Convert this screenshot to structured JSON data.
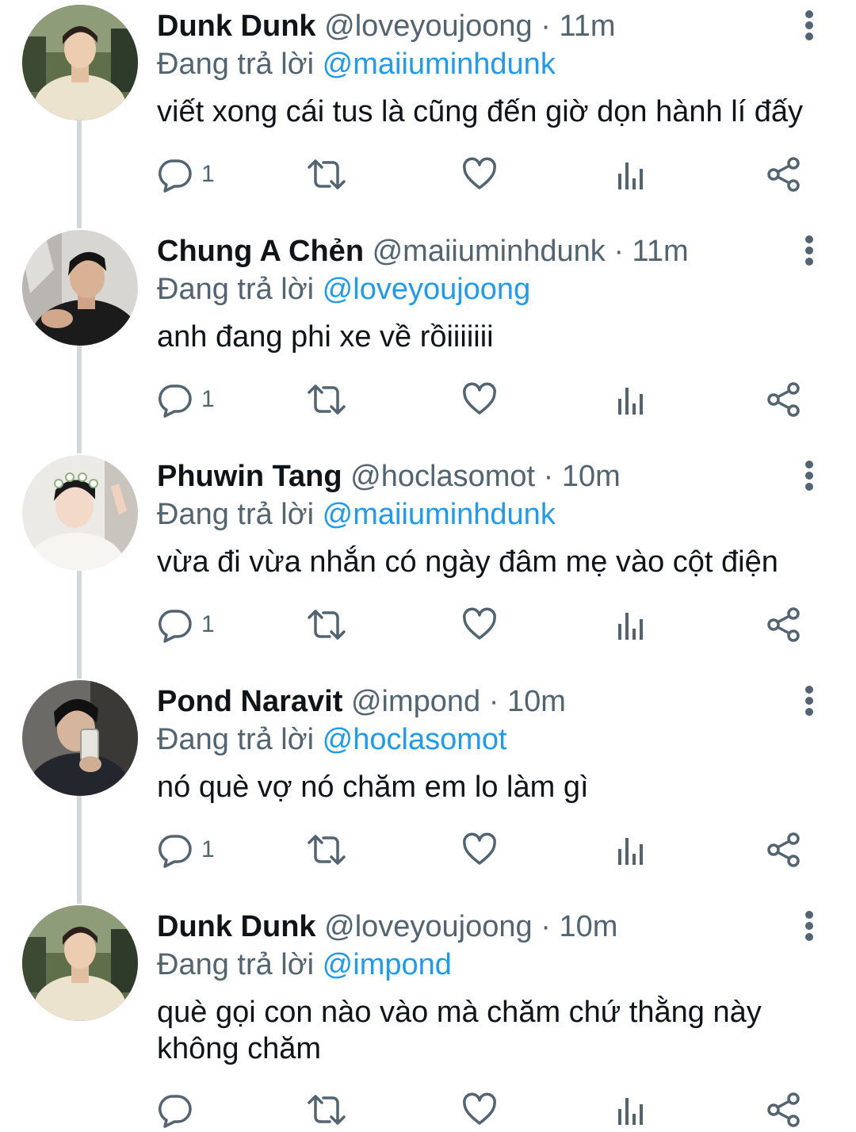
{
  "reply_prefix": "Đang trả lời",
  "separator": "·",
  "tweets": [
    {
      "name": "Dunk Dunk",
      "handle": "@loveyoujoong",
      "time": "11m",
      "reply_to": "@maiiuminhdunk",
      "text": "viết xong cái tus là cũng đến giờ dọn hành lí đấy",
      "reply_count": "1"
    },
    {
      "name": "Chung A Chẻn",
      "handle": "@maiiuminhdunk",
      "time": "11m",
      "reply_to": "@loveyoujoong",
      "text": "anh đang phi xe về rồiiiiiii",
      "reply_count": "1"
    },
    {
      "name": "Phuwin Tang",
      "handle": "@hoclasomot",
      "time": "10m",
      "reply_to": "@maiiuminhdunk",
      "text": "vừa đi vừa nhắn có ngày đâm mẹ vào cột điện",
      "reply_count": "1"
    },
    {
      "name": "Pond Naravit",
      "handle": "@impond",
      "time": "10m",
      "reply_to": "@hoclasomot",
      "text": "nó què vợ nó chăm em lo làm gì",
      "reply_count": "1"
    },
    {
      "name": "Dunk Dunk",
      "handle": "@loveyoujoong",
      "time": "10m",
      "reply_to": "@impond",
      "text": "què gọi con nào vào mà chăm chứ thằng này không chăm",
      "reply_count": ""
    }
  ],
  "icons": {
    "reply": "reply-icon",
    "retweet": "retweet-icon",
    "like": "heart-icon",
    "stats": "analytics-icon",
    "share": "share-icon",
    "more": "more-vertical-icon"
  },
  "colors": {
    "text": "#0f1419",
    "muted": "#536471",
    "mention": "#1d9bf0",
    "thread_line": "#cfd9de"
  }
}
